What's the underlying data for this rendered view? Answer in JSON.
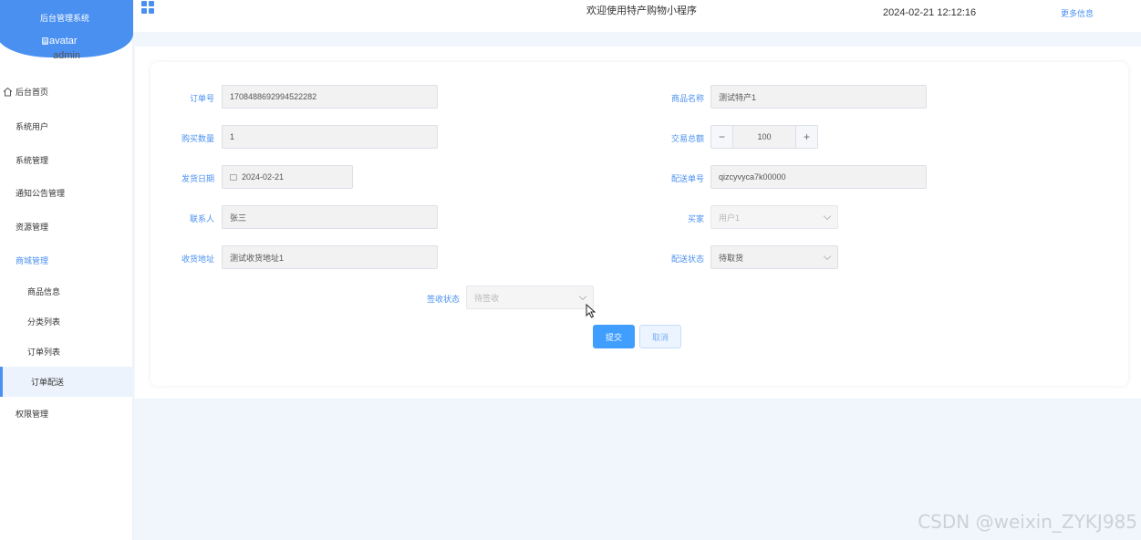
{
  "sidebar": {
    "system_title": "后台管理系统",
    "avatar_alt": "avatar",
    "username": "admin",
    "items": [
      {
        "label": "后台首页"
      },
      {
        "label": "系统用户"
      },
      {
        "label": "系统管理"
      },
      {
        "label": "通知公告管理"
      },
      {
        "label": "资源管理"
      },
      {
        "label": "商城管理"
      },
      {
        "label": "商品信息"
      },
      {
        "label": "分类列表"
      },
      {
        "label": "订单列表"
      },
      {
        "label": "订单配送"
      },
      {
        "label": "权限管理"
      }
    ]
  },
  "header": {
    "welcome": "欢迎使用特产购物小程序",
    "datetime": "2024-02-21 12:12:16",
    "more": "更多信息"
  },
  "form": {
    "order_no": {
      "label": "订单号",
      "value": "1708488692994522282"
    },
    "product_name": {
      "label": "商品名称",
      "value": "测试特产1"
    },
    "quantity": {
      "label": "购买数量",
      "value": "1"
    },
    "total": {
      "label": "交易总额",
      "value": "100",
      "minus": "−",
      "plus": "+"
    },
    "ship_date": {
      "label": "发货日期",
      "value": "2024-02-21"
    },
    "delivery_no": {
      "label": "配送单号",
      "value": "qizcyvyca7k00000"
    },
    "contact": {
      "label": "联系人",
      "value": "张三"
    },
    "buyer": {
      "label": "买家",
      "value": "用户1"
    },
    "address": {
      "label": "收货地址",
      "value": "测试收货地址1"
    },
    "delivery_status": {
      "label": "配送状态",
      "value": "待取货"
    },
    "sign_status": {
      "label": "签收状态",
      "value": "待签收"
    },
    "submit": "提交",
    "cancel": "取消"
  },
  "watermark": "CSDN @weixin_ZYKJ985",
  "colors": {
    "accent": "#4a90f0",
    "primary_button": "#409eff",
    "background": "#f0f6fc"
  }
}
